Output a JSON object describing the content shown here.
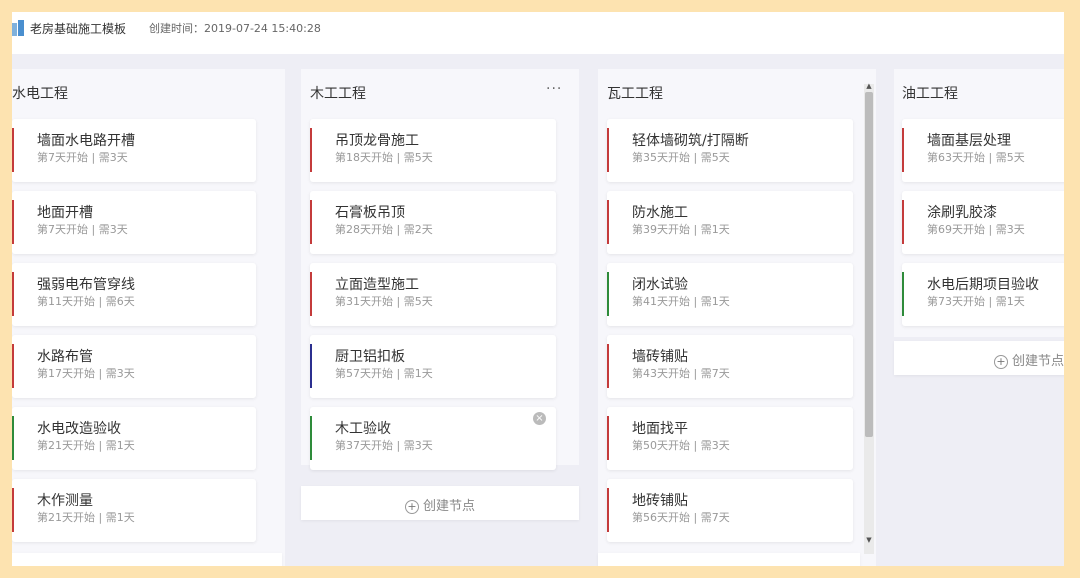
{
  "header": {
    "title": "老房基础施工模板",
    "created_label": "创建时间：2019-07-24 15:40:28"
  },
  "add_label": "创建节点",
  "columns": [
    {
      "title": "水电工程",
      "cards": [
        {
          "name": "墙面水电路开槽",
          "meta": "第7天开始 | 需3天",
          "color": "#c43b3b"
        },
        {
          "name": "地面开槽",
          "meta": "第7天开始 | 需3天",
          "color": "#c43b3b"
        },
        {
          "name": "强弱电布管穿线",
          "meta": "第11天开始 | 需6天",
          "color": "#c43b3b"
        },
        {
          "name": "水路布管",
          "meta": "第17天开始 | 需3天",
          "color": "#c43b3b"
        },
        {
          "name": "水电改造验收",
          "meta": "第21天开始 | 需1天",
          "color": "#2e8b3a"
        },
        {
          "name": "木作测量",
          "meta": "第21天开始 | 需1天",
          "color": "#c43b3b"
        }
      ]
    },
    {
      "title": "木工工程",
      "more": "···",
      "cards": [
        {
          "name": "吊顶龙骨施工",
          "meta": "第18天开始 | 需5天",
          "color": "#c43b3b"
        },
        {
          "name": "石膏板吊顶",
          "meta": "第28天开始 | 需2天",
          "color": "#c43b3b"
        },
        {
          "name": "立面造型施工",
          "meta": "第31天开始 | 需5天",
          "color": "#c43b3b"
        },
        {
          "name": "厨卫铝扣板",
          "meta": "第57天开始 | 需1天",
          "color": "#2b2f8f"
        },
        {
          "name": "木工验收",
          "meta": "第37天开始 | 需3天",
          "color": "#2e8b3a",
          "close": "×"
        }
      ]
    },
    {
      "title": "瓦工工程",
      "cards": [
        {
          "name": "轻体墙砌筑/打隔断",
          "meta": "第35天开始 | 需5天",
          "color": "#c43b3b"
        },
        {
          "name": "防水施工",
          "meta": "第39天开始 | 需1天",
          "color": "#c43b3b"
        },
        {
          "name": "闭水试验",
          "meta": "第41天开始 | 需1天",
          "color": "#2e8b3a"
        },
        {
          "name": "墙砖铺贴",
          "meta": "第43天开始 | 需7天",
          "color": "#c43b3b"
        },
        {
          "name": "地面找平",
          "meta": "第50天开始 | 需3天",
          "color": "#c43b3b"
        },
        {
          "name": "地砖铺贴",
          "meta": "第56天开始 | 需7天",
          "color": "#c43b3b"
        }
      ]
    },
    {
      "title": "油工工程",
      "cards": [
        {
          "name": "墙面基层处理",
          "meta": "第63天开始 | 需5天",
          "color": "#c43b3b"
        },
        {
          "name": "涂刷乳胶漆",
          "meta": "第69天开始 | 需3天",
          "color": "#c43b3b"
        },
        {
          "name": "水电后期项目验收",
          "meta": "第73天开始 | 需1天",
          "color": "#2e8b3a"
        }
      ]
    }
  ]
}
